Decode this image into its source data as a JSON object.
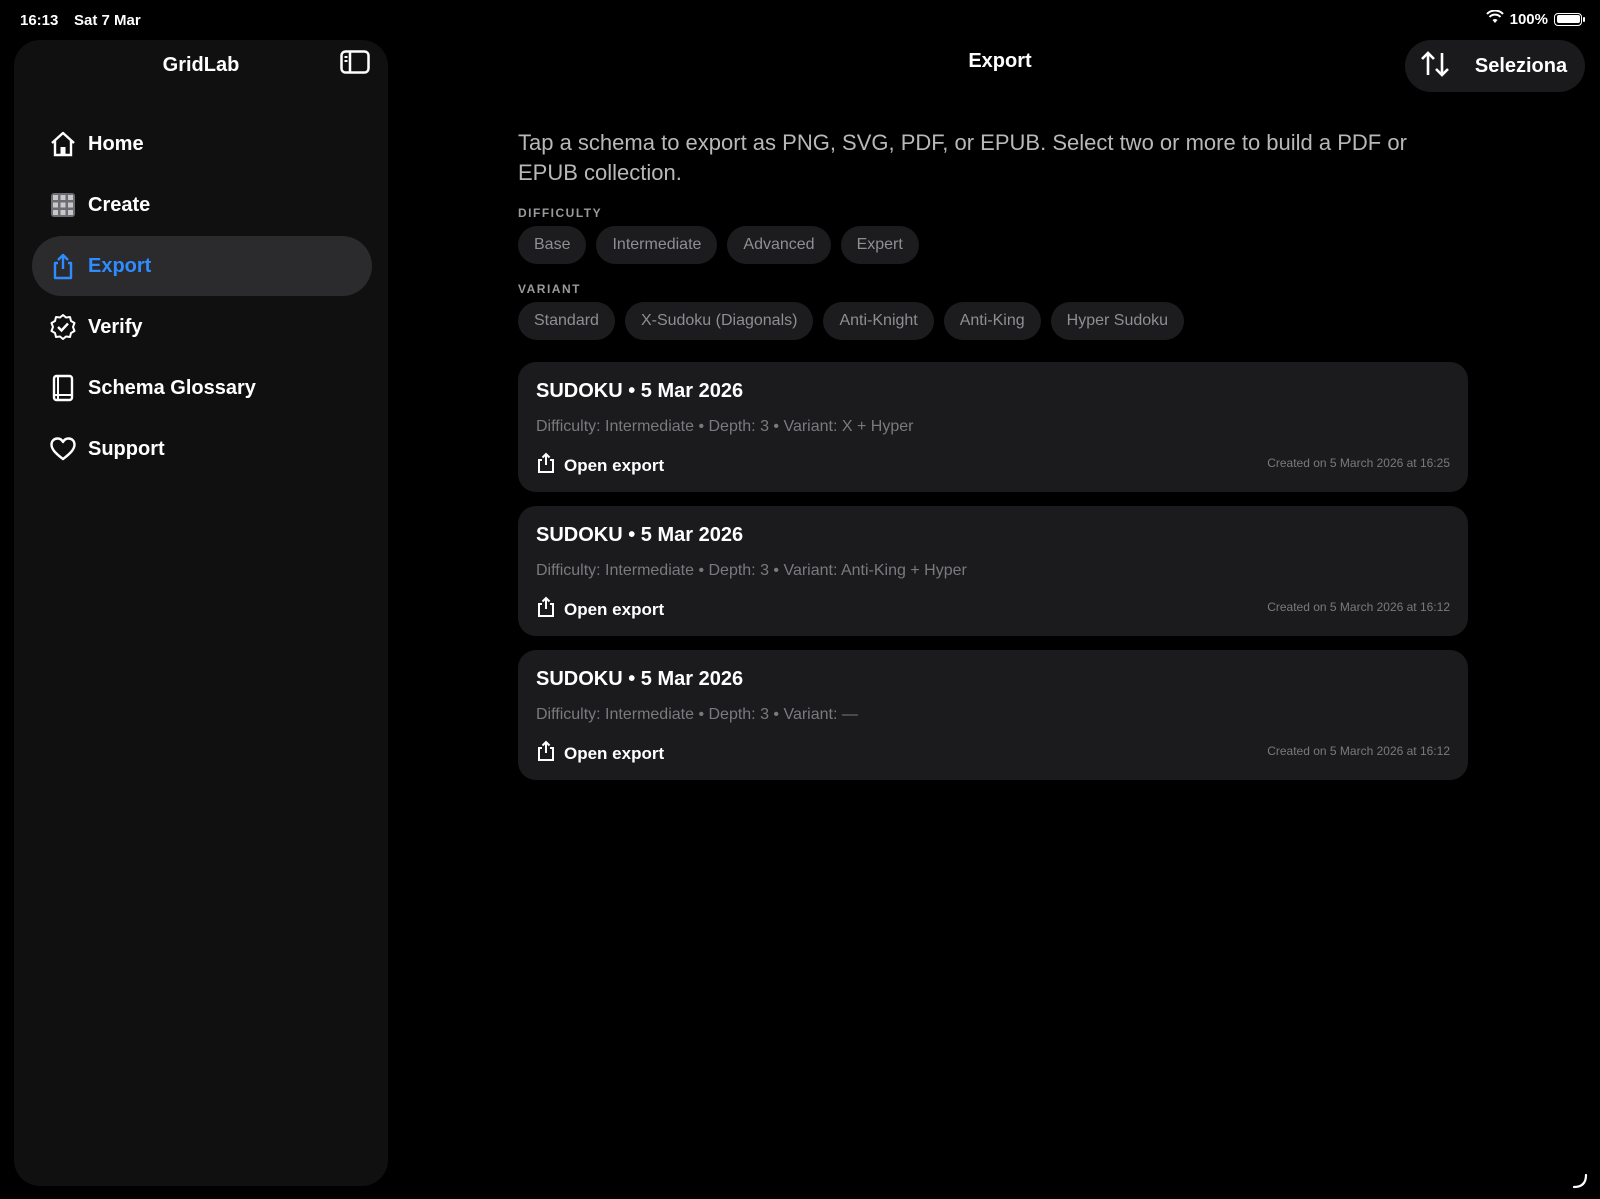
{
  "status_bar": {
    "time": "16:13",
    "date": "Sat 7 Mar",
    "battery": "100%"
  },
  "sidebar": {
    "title": "GridLab",
    "items": [
      {
        "label": "Home",
        "icon": "house-icon"
      },
      {
        "label": "Create",
        "icon": "grid-icon"
      },
      {
        "label": "Export",
        "icon": "share-icon",
        "active": true
      },
      {
        "label": "Verify",
        "icon": "checkmark-seal-icon"
      },
      {
        "label": "Schema Glossary",
        "icon": "book-icon"
      },
      {
        "label": "Support",
        "icon": "heart-icon"
      }
    ]
  },
  "header": {
    "title": "Export",
    "select_label": "Seleziona"
  },
  "main": {
    "intro": "Tap a schema to export as PNG, SVG, PDF, or EPUB. Select two or more to build a PDF or EPUB collection.",
    "difficulty_label": "DIFFICULTY",
    "difficulty_chips": [
      "Base",
      "Intermediate",
      "Advanced",
      "Expert"
    ],
    "variant_label": "VARIANT",
    "variant_chips": [
      "Standard",
      "X-Sudoku (Diagonals)",
      "Anti-Knight",
      "Anti-King",
      "Hyper Sudoku"
    ],
    "cards": [
      {
        "title": "SUDOKU • 5 Mar 2026",
        "meta": "Difficulty: Intermediate • Depth: 3 • Variant: X + Hyper",
        "action": "Open export",
        "created": "Created on 5 March 2026 at 16:25"
      },
      {
        "title": "SUDOKU • 5 Mar 2026",
        "meta": "Difficulty: Intermediate • Depth: 3 • Variant: Anti-King + Hyper",
        "action": "Open export",
        "created": "Created on 5 March 2026 at 16:12"
      },
      {
        "title": "SUDOKU • 5 Mar 2026",
        "meta": "Difficulty: Intermediate • Depth: 3 • Variant: —",
        "action": "Open export",
        "created": "Created on 5 March 2026 at 16:12"
      }
    ]
  },
  "colors": {
    "accent": "#2f8cff",
    "background": "#000000",
    "sidebar": "#101010",
    "card": "#1b1b1d"
  }
}
